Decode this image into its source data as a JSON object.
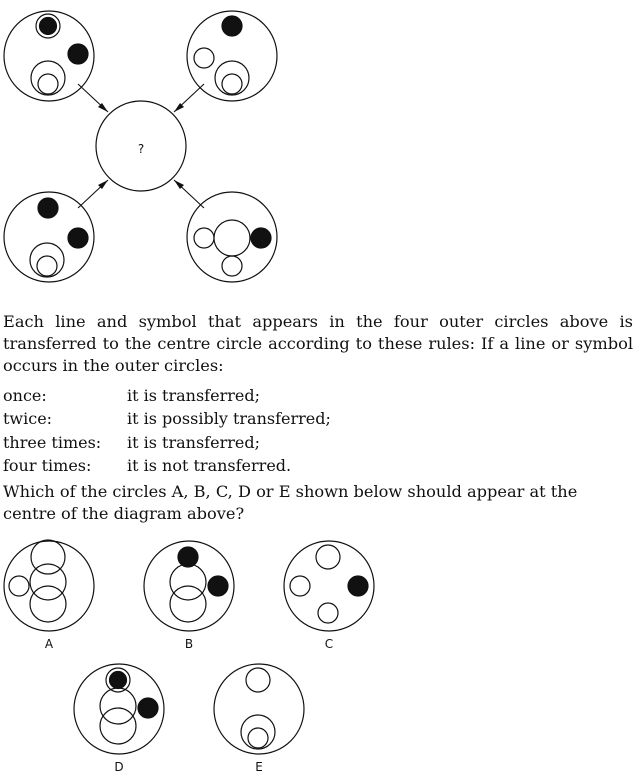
{
  "center_label": "?",
  "intro_text": "Each line and symbol that appears in the four outer circles above is transferred to the centre circle according to these rules: If a line or symbol occurs in the outer circles:",
  "rules": [
    {
      "condition": "once:",
      "result": "it is transferred;"
    },
    {
      "condition": "twice:",
      "result": "it is possibly transferred;"
    },
    {
      "condition": "three times:",
      "result": "it is transferred;"
    },
    {
      "condition": "four times:",
      "result": "it is not transferred."
    }
  ],
  "question_text": "Which of the circles A, B, C, D or E shown below should appear at the centre of the diagram above?",
  "options": [
    {
      "letter": "A"
    },
    {
      "letter": "B"
    },
    {
      "letter": "C"
    },
    {
      "letter": "D"
    },
    {
      "letter": "E"
    }
  ]
}
